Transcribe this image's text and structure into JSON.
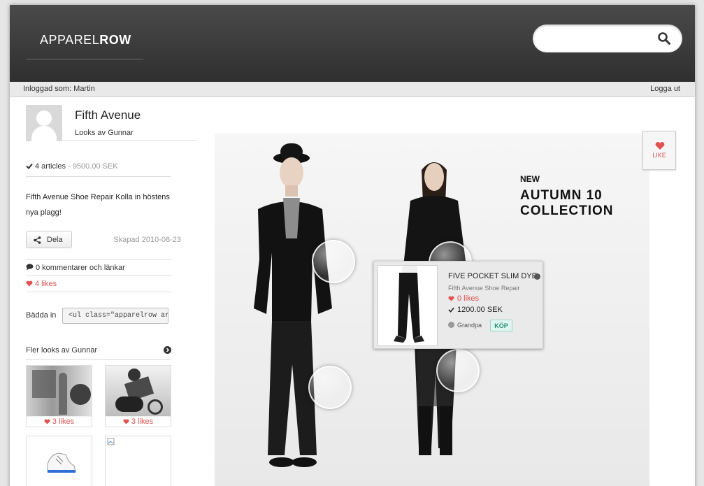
{
  "header": {
    "logo_light": "APPAREL",
    "logo_bold": "ROW",
    "search": {
      "placeholder": "",
      "value": ""
    }
  },
  "userbar": {
    "logged_in": "Inloggad som: Martin",
    "logout": "Logga ut"
  },
  "look": {
    "title": "Fifth Avenue",
    "subtitle": "Looks av Gunnar",
    "articles": "4 articles",
    "price": "- 9500.00 SEK",
    "description": "Fifth Avenue Shoe Repair Kolla in höstens nya plagg!",
    "share_label": "Dela",
    "created": "Skapad 2010-08-23",
    "comments": "0 kommentarer och länkar",
    "likes": "4 likes",
    "embed_label": "Bädda in",
    "embed_value": "<ul class=\"apparelrow ar-l"
  },
  "more_looks": {
    "heading": "Fler looks av Gunnar",
    "items": [
      {
        "likes": "3 likes"
      },
      {
        "likes": "3 likes"
      },
      {
        "likes": ""
      },
      {
        "likes": ""
      }
    ]
  },
  "campaign": {
    "line1": "NEW",
    "line2": "AUTUMN 10",
    "line3": "COLLECTION"
  },
  "product_popup": {
    "name": "FIVE POCKET SLIM DYE",
    "shop": "Fifth Avenue Shoe Repair",
    "likes": "0 likes",
    "price": "1200.00 SEK",
    "shopper": "Grandpa",
    "buy_label": "KÖP"
  },
  "like_button": {
    "label": "LIKE"
  },
  "colors": {
    "header_dark": "#2f2f2f",
    "like_red": "#e05252",
    "buy_green": "#2a8f75"
  }
}
